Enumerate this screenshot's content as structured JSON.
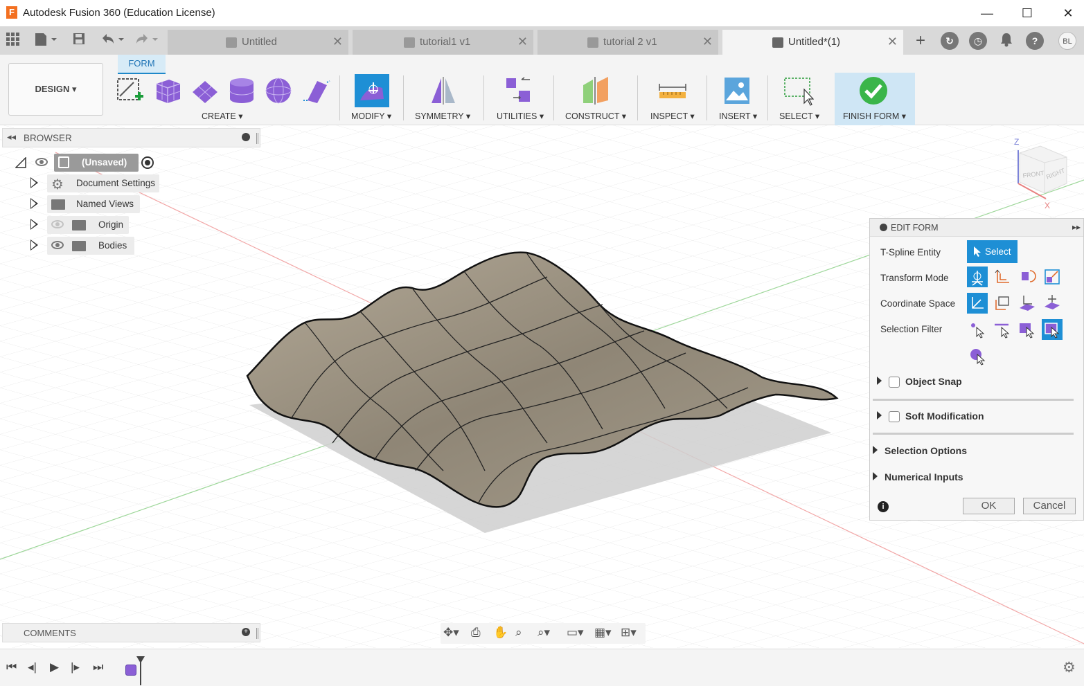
{
  "window": {
    "app_logo": "F",
    "title": "Autodesk Fusion 360 (Education License)",
    "minimize": "—",
    "maximize": "☐",
    "close": "✕"
  },
  "tabs": [
    {
      "label": "Untitled",
      "active": false
    },
    {
      "label": "tutorial1 v1",
      "active": false
    },
    {
      "label": "tutorial 2 v1",
      "active": false
    },
    {
      "label": "Untitled*(1)",
      "active": true
    }
  ],
  "user_initials": "BL",
  "toolbar": {
    "workspace": "DESIGN ▾",
    "active_tab": "FORM",
    "groups": {
      "create": "CREATE ▾",
      "modify": "MODIFY ▾",
      "symmetry": "SYMMETRY ▾",
      "utilities": "UTILITIES ▾",
      "construct": "CONSTRUCT ▾",
      "inspect": "INSPECT ▾",
      "insert": "INSERT ▾",
      "select": "SELECT ▾",
      "finish": "FINISH FORM ▾"
    }
  },
  "browser": {
    "title": "BROWSER",
    "root": "(Unsaved)",
    "items": [
      {
        "label": "Document Settings"
      },
      {
        "label": "Named Views"
      },
      {
        "label": "Origin"
      },
      {
        "label": "Bodies"
      }
    ]
  },
  "comments": {
    "title": "COMMENTS"
  },
  "viewcube": {
    "front": "FRONT",
    "right": "RIGHT",
    "z": "Z",
    "x": "X"
  },
  "edit_form": {
    "title": "EDIT FORM",
    "tspline_entity": "T-Spline Entity",
    "select_btn": "Select",
    "transform_mode": "Transform Mode",
    "coordinate_space": "Coordinate Space",
    "selection_filter": "Selection Filter",
    "object_snap": "Object Snap",
    "soft_modification": "Soft Modification",
    "selection_options": "Selection Options",
    "numerical_inputs": "Numerical Inputs",
    "ok": "OK",
    "cancel": "Cancel"
  },
  "colors": {
    "accent": "#1e8fd5",
    "surface": "#9a9080",
    "finish_green": "#3ab54a"
  }
}
